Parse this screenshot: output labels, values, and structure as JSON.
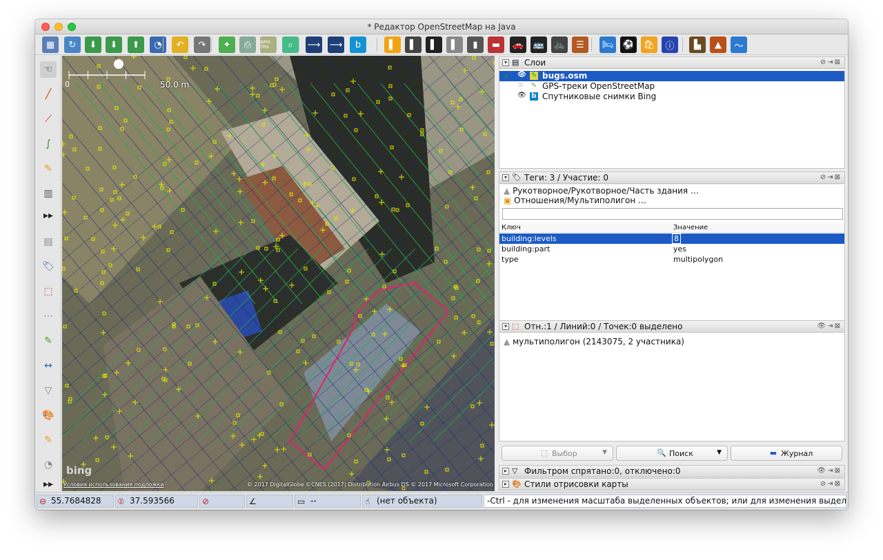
{
  "window": {
    "title": "* Редактор OpenStreetMap на Java"
  },
  "colors": {
    "selection": "#1c5ac5",
    "multipolygon_outline": "#e2226a",
    "osm_lines": "#22aa55",
    "nodes": "#e8e800"
  },
  "toolbar": {
    "icons": [
      "open-file-icon",
      "open-location-icon",
      "download-icon",
      "download-along-icon",
      "upload-icon",
      "upload-changes-icon",
      "undo-icon",
      "redo-icon",
      "zoom-fit-icon",
      "print-icon",
      "wms-tms-icon",
      "zoom-icon",
      "way-icon",
      "way-split-icon",
      "bing-icon",
      "road-icon",
      "road-icon-2",
      "road-icon-3",
      "road-icon-4",
      "traffic-light-icon",
      "barrier-icon",
      "car-icon",
      "bus-icon",
      "bicycle-icon",
      "railway-icon",
      "hotel-icon",
      "sport-icon",
      "shop-icon",
      "info-icon",
      "industry-icon",
      "peak-icon",
      "water-icon"
    ],
    "wms_label": "WMS TMS"
  },
  "lefttools": [
    "select-tool-icon",
    "draw-line-icon",
    "improve-way-icon",
    "draw-curve-icon",
    "draw-pencil-icon",
    "building-tool-icon",
    "more-tools-icon",
    "layers-toggle-icon",
    "tags-toggle-icon",
    "selection-list-icon",
    "relation-list-icon",
    "validator-icon",
    "conflict-icon",
    "filter-icon",
    "map-style-icon",
    "notes-icon",
    "history-icon",
    "more-toggles-icon"
  ],
  "map": {
    "scale_label": "50.0 m",
    "scale_zero": "0",
    "bing_logo": "bing",
    "terms_link": "Условия использования подложки",
    "attribution": "© 2017 DigitalGlobe ©CNES (2017) Distribution Airbus DS © 2017 Microsoft Corporation"
  },
  "layers_panel": {
    "title": "Слои",
    "items": [
      {
        "label": "bugs.osm",
        "selected": true,
        "active": true
      },
      {
        "label": "GPS-треки OpenStreetMap",
        "selected": false,
        "active": false
      },
      {
        "label": "Спутниковые снимки Bing",
        "selected": false,
        "active": false
      }
    ]
  },
  "tags_panel": {
    "title": "Теги: 3 / Участие: 0",
    "preset_lines": [
      "Рукотворное/Рукотворное/Часть здания …",
      "Отношения/Мультиполигон …"
    ],
    "columns": [
      "Ключ",
      "Значение"
    ],
    "rows": [
      {
        "key": "building:levels",
        "value": "8",
        "selected": true
      },
      {
        "key": "building:part",
        "value": "yes",
        "selected": false
      },
      {
        "key": "type",
        "value": "multipolygon",
        "selected": false
      }
    ]
  },
  "selection_panel": {
    "title": "Отн.:1 / Линий:0 / Точек:0 выделено",
    "items": [
      "мультиполигон (2143075, 2 участника)"
    ],
    "buttons": {
      "select": "Выбор",
      "search": "Поиск",
      "history": "Журнал"
    }
  },
  "filter_panel": {
    "title": "Фильтром спрятано:0, отключено:0"
  },
  "style_panel": {
    "title": "Стили отрисовки карты"
  },
  "statusbar": {
    "lat": "55.7684828",
    "lon": "37.593566",
    "heading": "",
    "angle": "",
    "distance": "--",
    "object": "(нет объекта)",
    "hint": "-Ctrl - для изменения масштаба выделенных объектов; или для изменения выделения"
  }
}
